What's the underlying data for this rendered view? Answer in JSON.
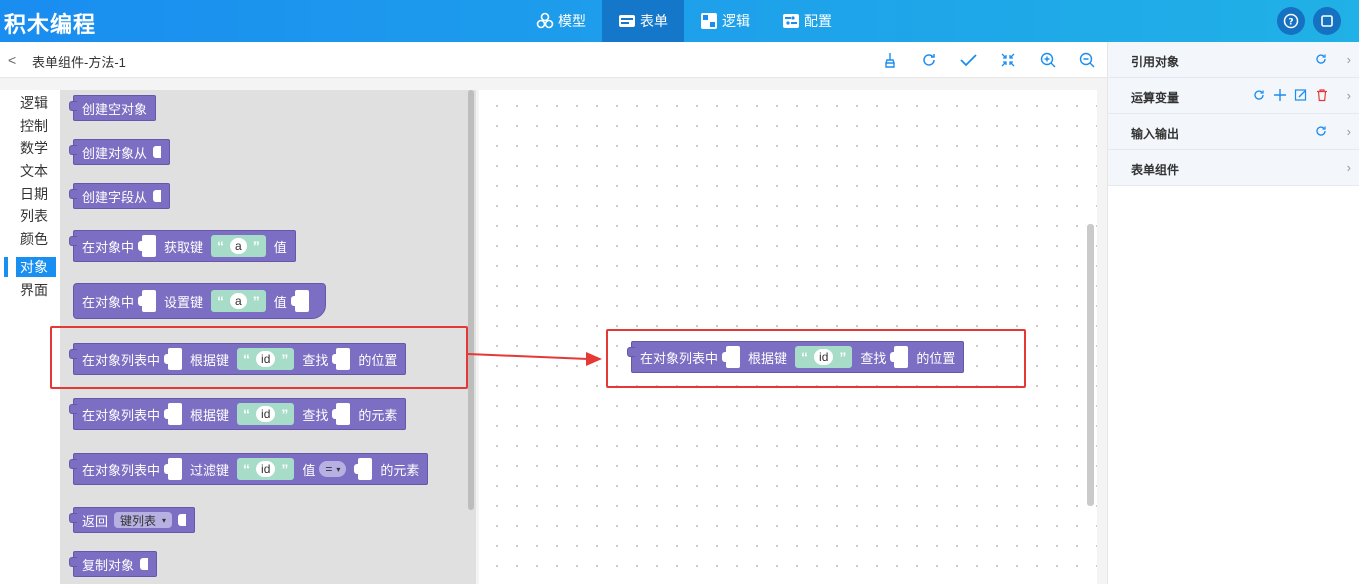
{
  "app": {
    "title": "积木编程"
  },
  "nav": {
    "items": [
      {
        "label": "模型",
        "icon": "model-icon"
      },
      {
        "label": "表单",
        "icon": "form-icon",
        "active": true
      },
      {
        "label": "逻辑",
        "icon": "logic-icon"
      },
      {
        "label": "配置",
        "icon": "config-icon"
      }
    ]
  },
  "header_buttons": {
    "help": "help-icon",
    "window": "window-icon"
  },
  "subbar": {
    "back": "<",
    "title": "表单组件-方法-1"
  },
  "toolbar_icons": [
    "brush-icon",
    "refresh-icon",
    "check-icon",
    "fit-icon",
    "zoom-in-icon",
    "zoom-out-icon"
  ],
  "toolbox": {
    "categories": [
      "逻辑",
      "控制",
      "数学",
      "文本",
      "日期",
      "列表",
      "颜色",
      "对象",
      "界面"
    ],
    "active": "对象"
  },
  "blocks": {
    "create_empty": "创建空对象",
    "create_from": "创建对象从",
    "create_field_from": "创建字段从",
    "get_prefix": "在对象中",
    "get_key": "获取键",
    "get_str": "a",
    "get_suffix": "值",
    "set_prefix": "在对象中",
    "set_key": "设置键",
    "set_str": "a",
    "set_suffix": "值",
    "find_pos_prefix": "在对象列表中",
    "find_pos_key": "根据键",
    "find_pos_str": "id",
    "find_pos_mid": "查找",
    "find_pos_suffix": "的位置",
    "find_el_prefix": "在对象列表中",
    "find_el_key": "根据键",
    "find_el_str": "id",
    "find_el_mid": "查找",
    "find_el_suffix": "的元素",
    "filter_prefix": "在对象列表中",
    "filter_key": "过滤键",
    "filter_str": "id",
    "filter_mid": "值",
    "filter_op": "=",
    "filter_suffix": "的元素",
    "return_label": "返回",
    "return_dd": "键列表",
    "copy_label": "复制对象"
  },
  "canvas_block": {
    "prefix": "在对象列表中",
    "key": "根据键",
    "str": "id",
    "mid": "查找",
    "suffix": "的位置"
  },
  "right_panel": {
    "rows": [
      {
        "label": "引用对象"
      },
      {
        "label": "运算变量"
      },
      {
        "label": "输入输出"
      },
      {
        "label": "表单组件"
      }
    ]
  },
  "colors": {
    "header": "#1a8df0",
    "block": "#7c6fc3",
    "string": "#a6dcc8",
    "highlight": "#e53935",
    "active_cat": "#1a8ff2"
  }
}
